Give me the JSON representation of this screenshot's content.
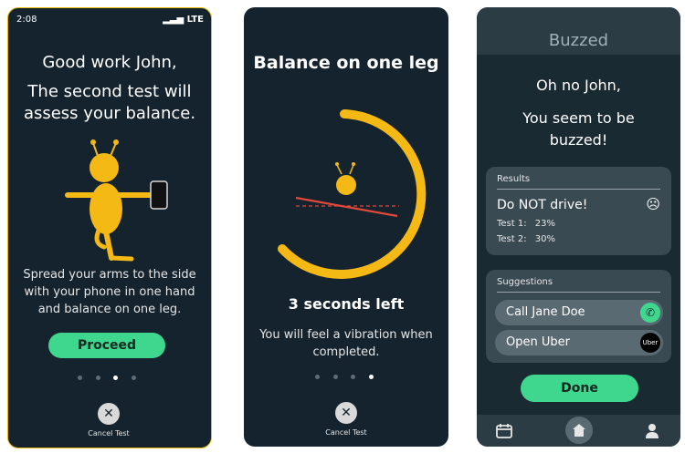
{
  "screen1": {
    "status_time": "2:08",
    "status_signal": "LTE",
    "greeting": "Good work John,",
    "headline": "The second test will assess your balance.",
    "instructions": "Spread your arms to the side with your phone in one hand and balance on one leg.",
    "proceed_label": "Proceed",
    "cancel_label": "Cancel Test",
    "progress_dots": 4,
    "active_dot": 3
  },
  "screen2": {
    "title": "Balance on one leg",
    "countdown": "3 seconds left",
    "note": "You will feel a vibration when completed.",
    "cancel_label": "Cancel Test",
    "progress_dots": 4,
    "active_dot": 4
  },
  "screen3": {
    "app_title": "Buzzed",
    "greeting": "Oh no John,",
    "message": "You seem to be buzzed!",
    "results": {
      "title": "Results",
      "verdict": "Do NOT drive!",
      "tests": [
        {
          "label": "Test 1:",
          "value": "23%"
        },
        {
          "label": "Test 2:",
          "value": "30%"
        }
      ]
    },
    "suggestions": {
      "title": "Suggestions",
      "items": [
        {
          "label": "Call Jane Doe",
          "icon": "phone-icon"
        },
        {
          "label": "Open Uber",
          "icon": "uber-icon",
          "icon_text": "Uber"
        }
      ]
    },
    "done_label": "Done",
    "nav": [
      "calendar-icon",
      "home-icon",
      "profile-icon"
    ]
  },
  "colors": {
    "background": "#14232d",
    "accent_yellow": "#f5b915",
    "accent_green": "#3fd68e",
    "danger_red": "#e0483c"
  }
}
